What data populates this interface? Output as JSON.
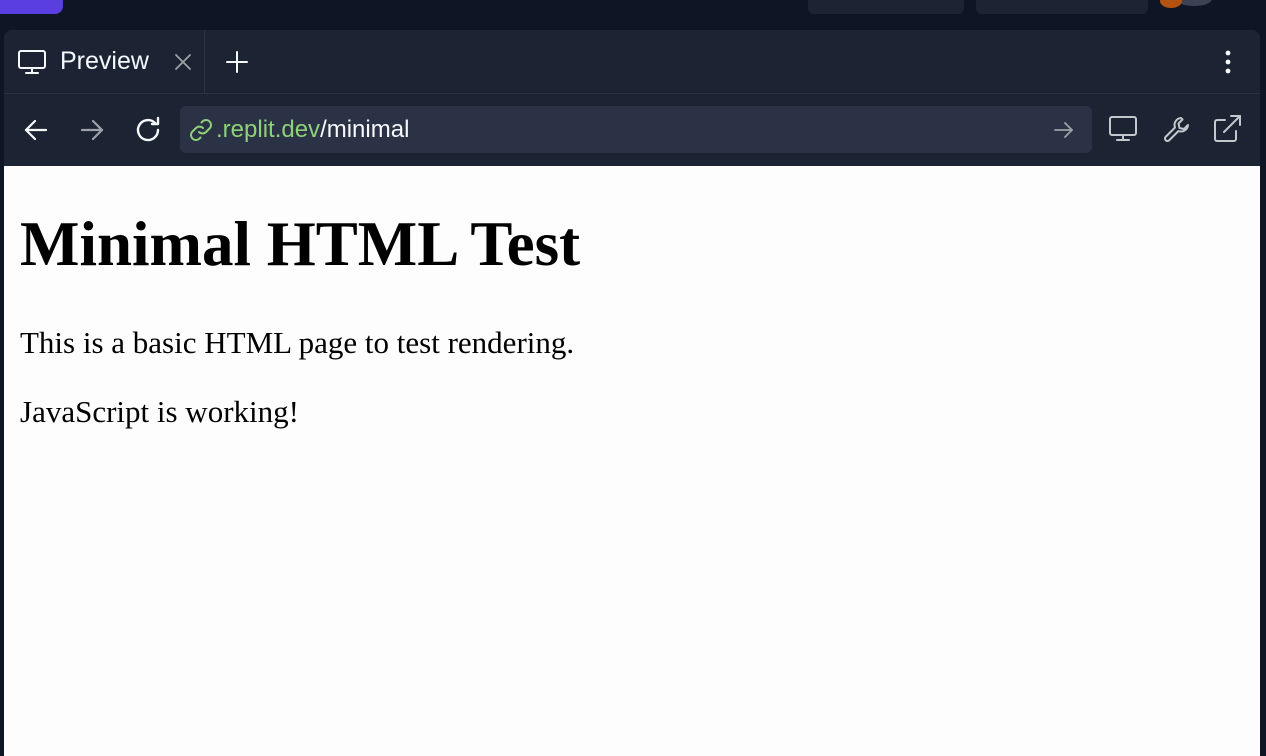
{
  "tab": {
    "label": "Preview",
    "icon": "monitor-icon"
  },
  "url": {
    "domain": ".replit.dev",
    "path": "/minimal"
  },
  "content": {
    "heading": "Minimal HTML Test",
    "paragraph1": "This is a basic HTML page to test rendering.",
    "paragraph2": "JavaScript is working!"
  },
  "colors": {
    "app_bg": "#0e1525",
    "pane_bg": "#1c2333",
    "urlbar_bg": "#2b3245",
    "domain_green": "#8fd07a",
    "accent_purple": "#5b3ee0",
    "page_bg": "#fdfdfd"
  },
  "icons": [
    "monitor-icon",
    "close-icon",
    "plus-icon",
    "kebab-menu-icon",
    "arrow-left-icon",
    "arrow-right-icon",
    "reload-icon",
    "link-icon",
    "go-arrow-icon",
    "device-icon",
    "wrench-icon",
    "external-link-icon"
  ]
}
